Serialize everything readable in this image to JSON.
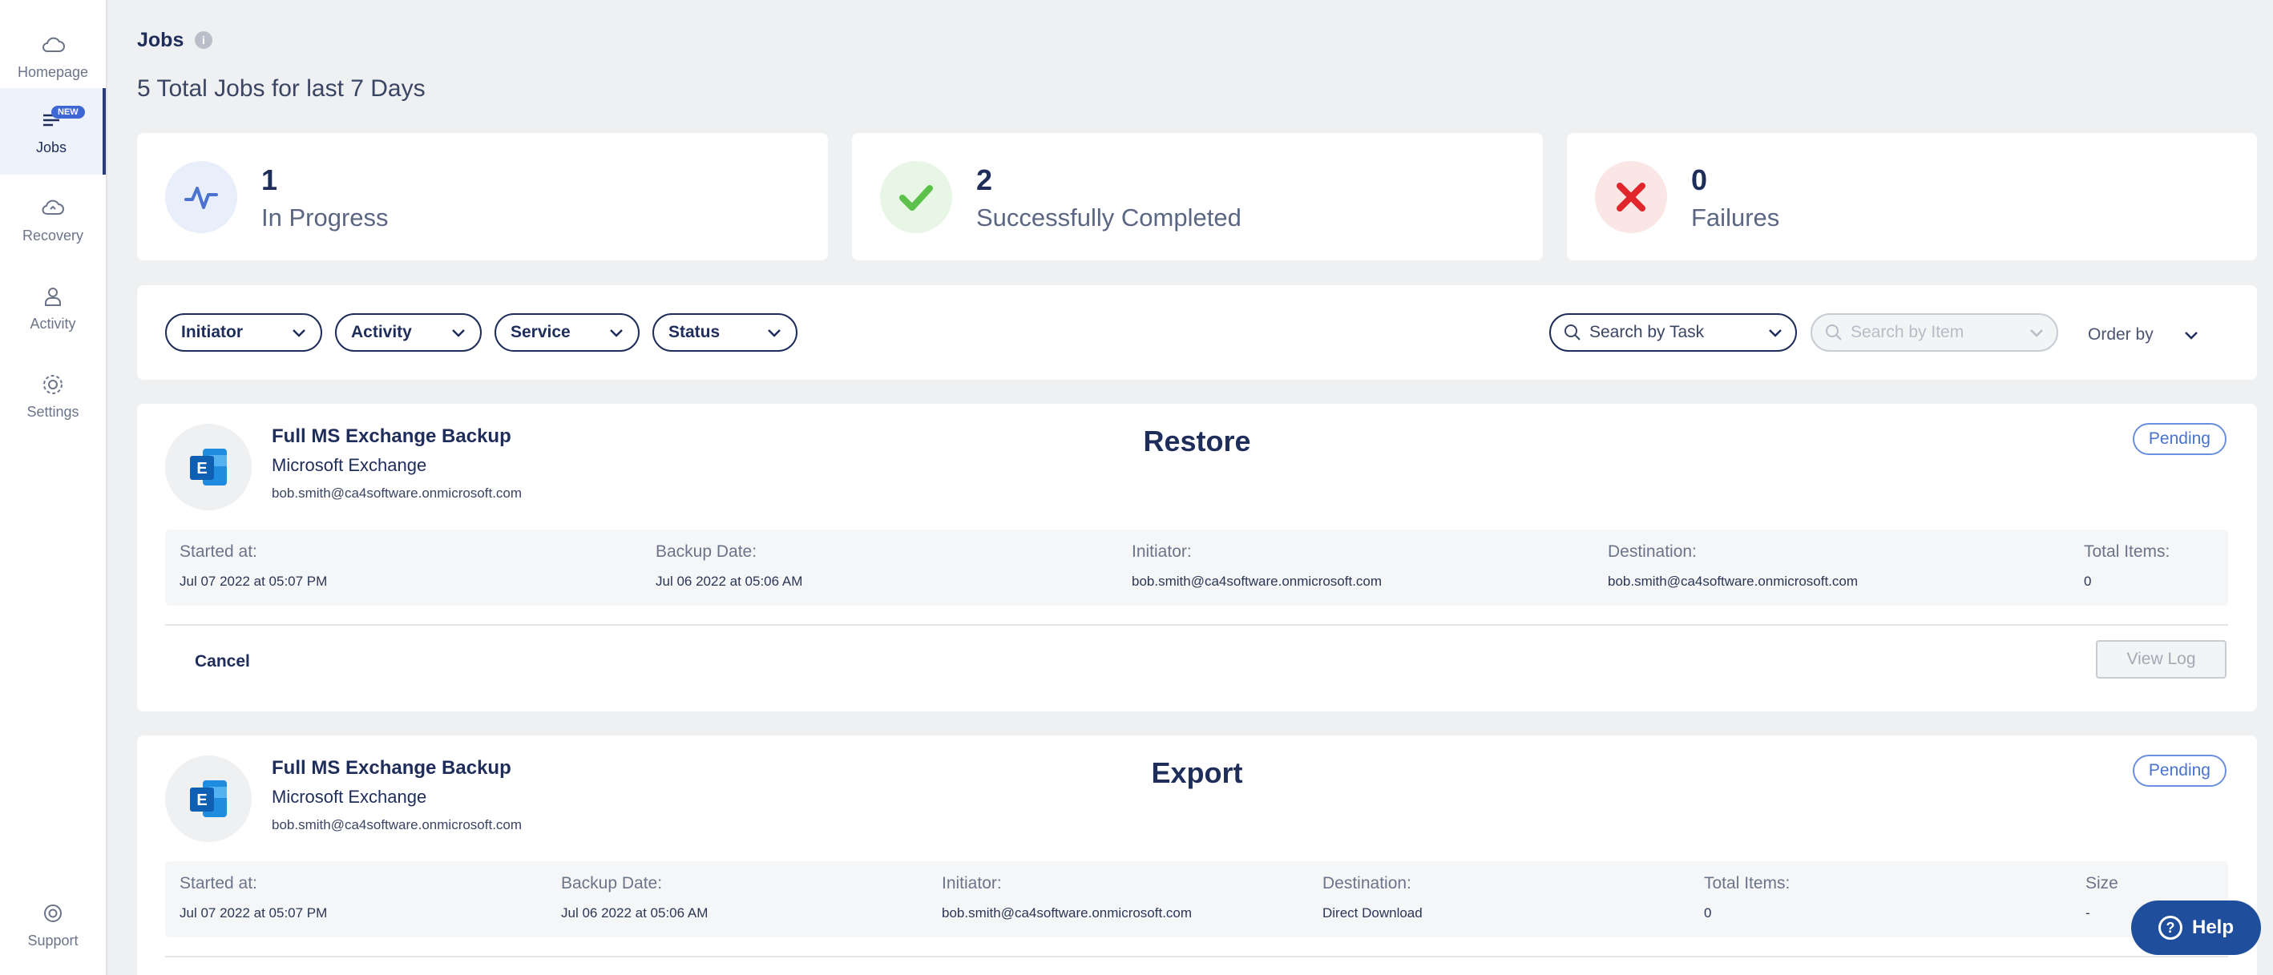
{
  "sidebar": {
    "items": [
      {
        "label": "Homepage",
        "icon": "cloud-icon"
      },
      {
        "label": "Jobs",
        "icon": "jobs-icon",
        "badge": "NEW",
        "active": true
      },
      {
        "label": "Recovery",
        "icon": "recovery-icon"
      },
      {
        "label": "Activity",
        "icon": "user-icon"
      },
      {
        "label": "Settings",
        "icon": "gear-icon"
      }
    ],
    "support": {
      "label": "Support",
      "icon": "lifebuoy-icon"
    }
  },
  "header": {
    "title": "Jobs",
    "subtitle": "5 Total Jobs for last 7 Days"
  },
  "stats": [
    {
      "count": "1",
      "label": "In Progress",
      "icon": "activity-pulse-icon",
      "color": "#4a72cf"
    },
    {
      "count": "2",
      "label": "Successfully Completed",
      "icon": "check-icon",
      "color": "#5cc14a"
    },
    {
      "count": "0",
      "label": "Failures",
      "icon": "x-icon",
      "color": "#e0262c"
    }
  ],
  "filters": {
    "initiator": "Initiator",
    "activity": "Activity",
    "service": "Service",
    "status": "Status",
    "search_task": "Search by Task",
    "search_item": "Search by Item",
    "order_by": "Order by"
  },
  "jobs": [
    {
      "name": "Full MS Exchange Backup",
      "service": "Microsoft Exchange",
      "email": "bob.smith@ca4software.onmicrosoft.com",
      "type": "Restore",
      "status": "Pending",
      "details": [
        {
          "label": "Started at:",
          "value": "Jul 07 2022 at 05:07 PM"
        },
        {
          "label": "Backup Date:",
          "value": "Jul 06 2022 at 05:06 AM"
        },
        {
          "label": "Initiator:",
          "value": "bob.smith@ca4software.onmicrosoft.com"
        },
        {
          "label": "Destination:",
          "value": "bob.smith@ca4software.onmicrosoft.com"
        },
        {
          "label": "Total Items:",
          "value": "0"
        }
      ],
      "cancel": "Cancel",
      "view_log": "View Log"
    },
    {
      "name": "Full MS Exchange Backup",
      "service": "Microsoft Exchange",
      "email": "bob.smith@ca4software.onmicrosoft.com",
      "type": "Export",
      "status": "Pending",
      "details": [
        {
          "label": "Started at:",
          "value": "Jul 07 2022 at 05:07 PM"
        },
        {
          "label": "Backup Date:",
          "value": "Jul 06 2022 at 05:06 AM"
        },
        {
          "label": "Initiator:",
          "value": "bob.smith@ca4software.onmicrosoft.com"
        },
        {
          "label": "Destination:",
          "value": "Direct Download"
        },
        {
          "label": "Total Items:",
          "value": "0"
        },
        {
          "label": "Size",
          "value": "-"
        }
      ]
    }
  ],
  "help": {
    "label": "Help"
  }
}
